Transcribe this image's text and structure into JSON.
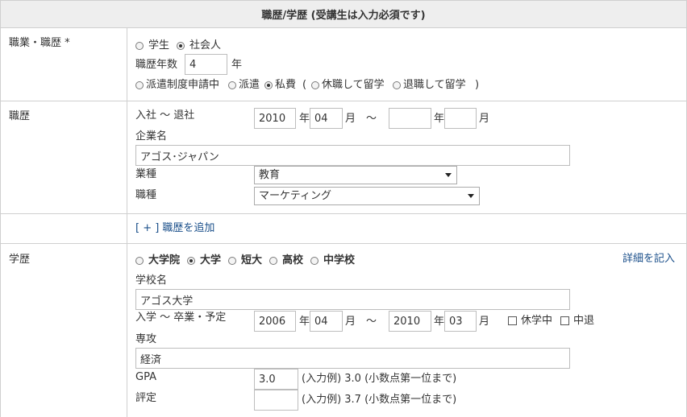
{
  "header": {
    "title": "職歴/学歴 (受講生は入力必須です)"
  },
  "occupation": {
    "label": "職業・職歴 *",
    "status_options": [
      {
        "label": "学生",
        "checked": false
      },
      {
        "label": "社会人",
        "checked": true
      }
    ],
    "years_label": "職歴年数",
    "years_value": "4",
    "years_unit": "年",
    "dispatch_options": [
      {
        "label": "派遣制度申請中",
        "checked": false
      },
      {
        "label": "派遣",
        "checked": false
      },
      {
        "label": "私費",
        "checked": true
      },
      {
        "label": "休職して留学",
        "checked": false
      },
      {
        "label": "退職して留学",
        "checked": false
      }
    ],
    "paren_open": "(",
    "paren_close": ")"
  },
  "career": {
    "label": "職歴",
    "period_label": "入社 ～ 退社",
    "start_year": "2010",
    "start_month": "04",
    "end_year": "",
    "end_month": "",
    "year_unit": "年",
    "month_unit": "月",
    "tilde": "～",
    "company_label": "企業名",
    "company_value": "アゴス･ジャパン",
    "industry_label": "業種",
    "industry_value": "教育",
    "job_label": "職種",
    "job_value": "マーケティング",
    "add_link": "[ + ] 職歴を追加"
  },
  "education": {
    "label": "学歴",
    "detail_link": "詳細を記入",
    "level_options": [
      {
        "label": "大学院",
        "checked": false
      },
      {
        "label": "大学",
        "checked": true
      },
      {
        "label": "短大",
        "checked": false
      },
      {
        "label": "高校",
        "checked": false
      },
      {
        "label": "中学校",
        "checked": false
      }
    ],
    "school_label": "学校名",
    "school_value": "アゴス大学",
    "period_label": "入学 ～ 卒業・予定",
    "start_year": "2006",
    "start_month": "04",
    "end_year": "2010",
    "end_month": "03",
    "leave_label": "休学中",
    "dropout_label": "中退",
    "major_label": "専攻",
    "major_value": "経済",
    "gpa_label": "GPA",
    "gpa_value": "3.0",
    "gpa_hint": "(入力例) 3.0 (小数点第一位まで)",
    "rating_label": "評定",
    "rating_value": "",
    "rating_hint": "(入力例) 3.7 (小数点第一位まで)"
  }
}
